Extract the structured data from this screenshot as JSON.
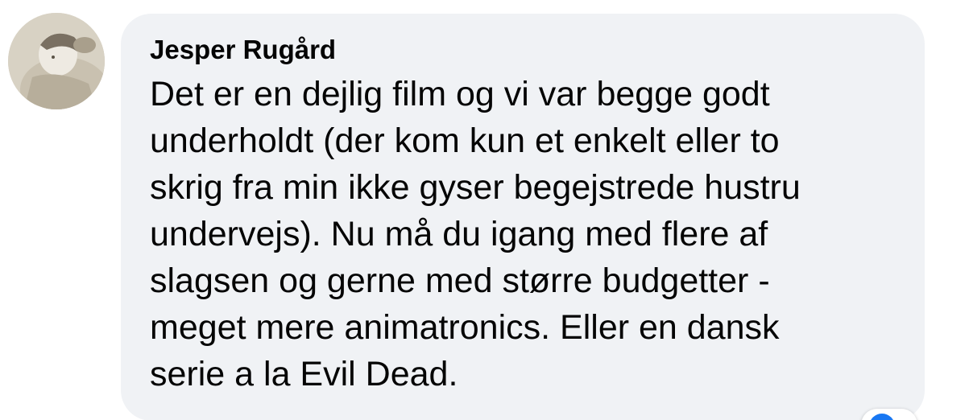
{
  "comment": {
    "author": "Jesper Rugård",
    "lines": [
      "Det er en dejlig film og vi var begge godt",
      "underholdt (der kom kun et enkelt eller to",
      "skrig fra min ikke gyser begejstrede hustru",
      "undervejs). Nu må du igang med flere af",
      "slagsen og gerne med større budgetter -",
      "meget mere animatronics. Eller en dansk",
      "serie a la Evil Dead."
    ]
  },
  "colors": {
    "bubble_background": "#f0f2f5",
    "text": "#050505",
    "reaction_accent": "#1877f2"
  },
  "icons": {
    "avatar": "user-photo-avatar",
    "reaction": "like-reaction-icon"
  }
}
